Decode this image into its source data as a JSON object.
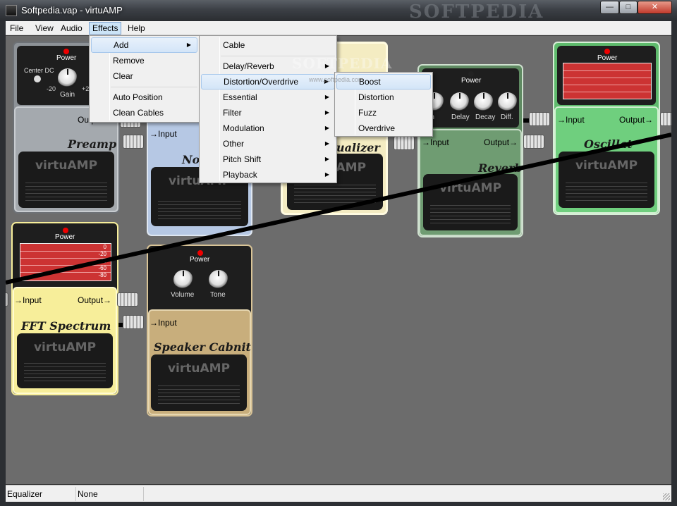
{
  "window": {
    "title": "Softpedia.vap - virtuAMP",
    "watermark": "SOFTPEDIA",
    "buttons": {
      "minimize": "—",
      "maximize": "□",
      "close": "✕"
    }
  },
  "menubar": {
    "file": "File",
    "view": "View",
    "audio": "Audio",
    "effects": "Effects",
    "help": "Help"
  },
  "effects_menu": {
    "add": "Add",
    "remove": "Remove",
    "clear": "Clear",
    "auto_position": "Auto Position",
    "clean_cables": "Clean Cables"
  },
  "add_menu": {
    "cable": "Cable",
    "delay_reverb": "Delay/Reverb",
    "distortion_overdrive": "Distortion/Overdrive",
    "essential": "Essential",
    "filter": "Filter",
    "modulation": "Modulation",
    "other": "Other",
    "pitch_shift": "Pitch Shift",
    "playback": "Playback"
  },
  "distortion_menu": {
    "boost": "Boost",
    "distortion": "Distortion",
    "fuzz": "Fuzz",
    "overdrive": "Overdrive"
  },
  "pedals": {
    "brand": "virtuAMP",
    "power": "Power",
    "input": "→Input",
    "output": "Output→",
    "preamp": {
      "name": "Preamp",
      "center_dc": "Center DC",
      "gain": "Gain",
      "min": "-20",
      "max": "+20",
      "output": "Output"
    },
    "noise": {
      "name": "No"
    },
    "equalizer": {
      "name": "ualizer"
    },
    "reverb": {
      "name": "Reverb",
      "depth": "pth",
      "delay": "Delay",
      "decay": "Decay",
      "diff": "Diff."
    },
    "oscillator": {
      "name": "Oscillat"
    },
    "fft": {
      "name": "FFT Spectrum",
      "scale": [
        "0",
        "-20",
        "-40",
        "-60",
        "-80"
      ]
    },
    "speaker": {
      "name": "Speaker Cabnit",
      "volume": "Volume",
      "tone": "Tone"
    }
  },
  "overlay_watermark": {
    "text": "SOFTPEDIA",
    "url": "www.softpedia.com"
  },
  "statusbar": {
    "left": "Equalizer",
    "right": "None"
  },
  "colors": {
    "preamp_body": "#a4a9ae",
    "noise_body": "#b6c8e4",
    "equalizer_body": "#f4ecc2",
    "reverb_body": "#6f9c72",
    "oscillator_body": "#6fcf7e",
    "fft_body": "#f7ee9a",
    "speaker_body": "#c8ae7c",
    "workspace": "#6c6c6c"
  }
}
